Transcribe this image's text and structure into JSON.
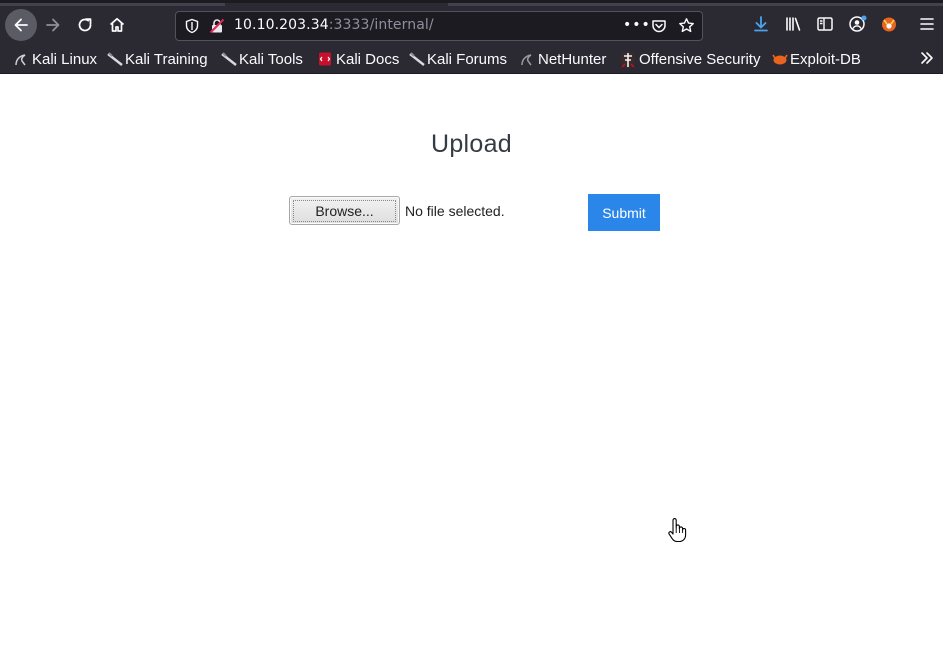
{
  "browser": {
    "url_host": "10.10.203.34",
    "url_rest": ":3333/internal/",
    "url_actions_glyph": "•••",
    "icons": {
      "back": "back-arrow-icon",
      "forward": "forward-arrow-icon",
      "reload": "reload-icon",
      "home": "home-icon",
      "tracking": "shield-icon",
      "insecure": "insecure-lock-icon",
      "pocket": "pocket-icon",
      "bookmark": "star-icon",
      "downloads": "download-arrow-icon",
      "library": "library-icon",
      "sidebar": "sidebar-icon",
      "account": "account-icon",
      "extension": "extension-fox-icon",
      "menu": "hamburger-menu-icon",
      "overflow": "chevron-double-right-icon"
    },
    "colors": {
      "toolbar": "#2b2a33",
      "urlbar": "#1c1b22",
      "download_accent": "#4aa3f0"
    }
  },
  "bookmarks": [
    {
      "label": "Kali Linux",
      "icon": "kali-dragon-icon"
    },
    {
      "label": "Kali Training",
      "icon": "kali-sword-icon"
    },
    {
      "label": "Kali Tools",
      "icon": "kali-sword-icon"
    },
    {
      "label": "Kali Docs",
      "icon": "kali-docs-icon"
    },
    {
      "label": "Kali Forums",
      "icon": "kali-sword-icon"
    },
    {
      "label": "NetHunter",
      "icon": "nethunter-icon"
    },
    {
      "label": "Offensive Security",
      "icon": "offsec-icon"
    },
    {
      "label": "Exploit-DB",
      "icon": "exploit-db-icon"
    }
  ],
  "page": {
    "title": "Upload",
    "browse_label": "Browse...",
    "file_status": "No file selected.",
    "submit_label": "Submit",
    "colors": {
      "submit": "#2a86e8",
      "title": "#333b44"
    }
  }
}
